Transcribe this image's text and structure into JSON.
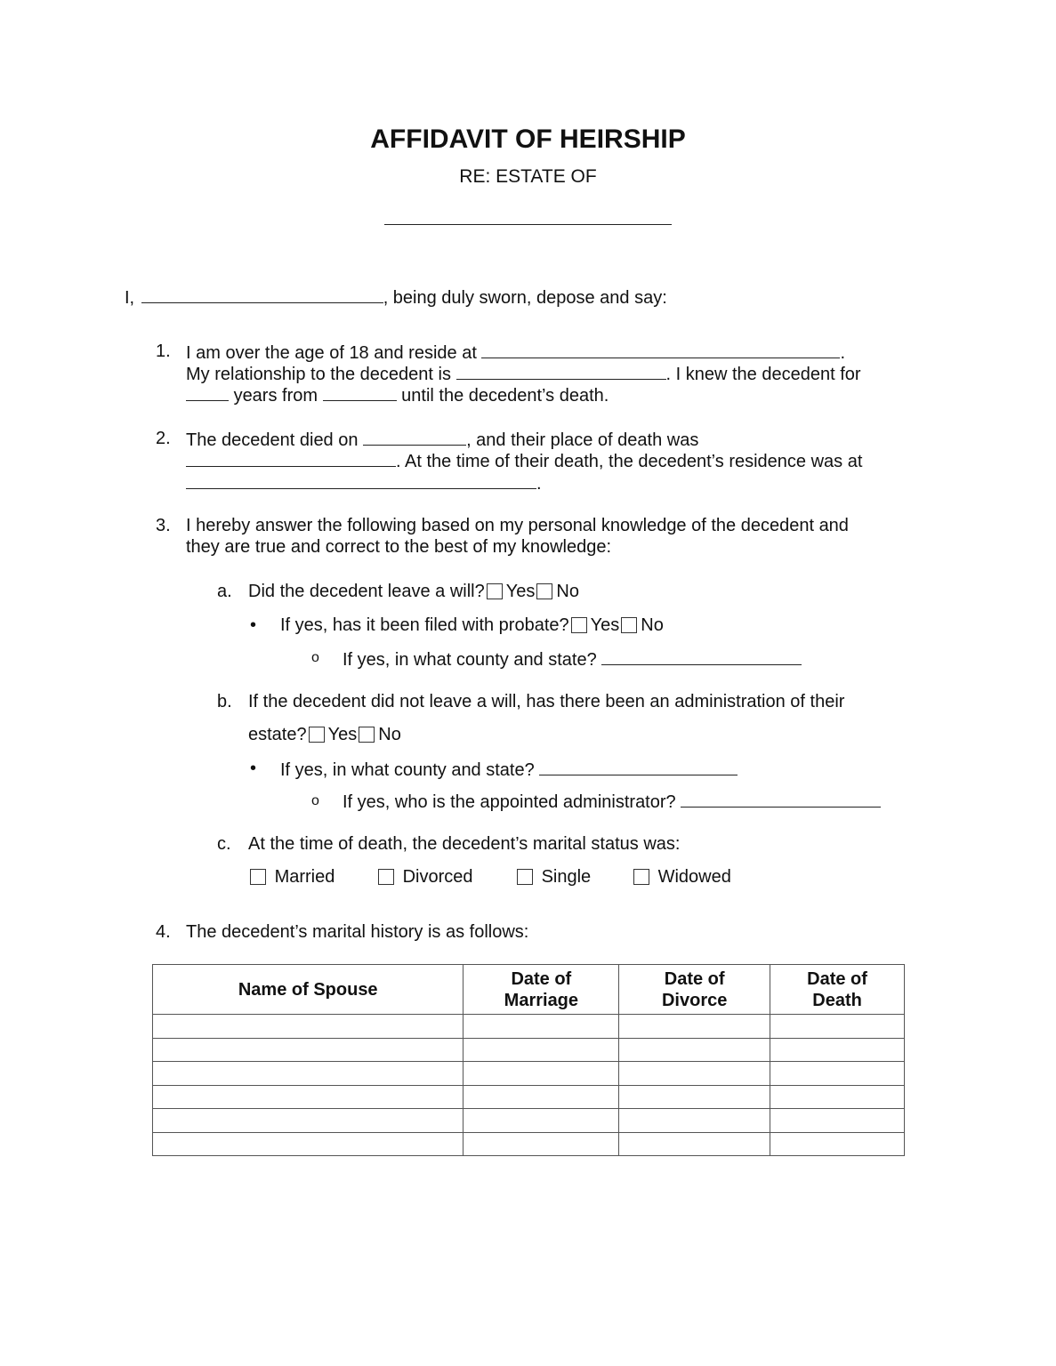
{
  "header": {
    "title": "AFFIDAVIT OF HEIRSHIP",
    "subtitle": "RE: ESTATE OF"
  },
  "intro": {
    "prefix": "I,",
    "suffix": ", being duly sworn, depose and say:"
  },
  "item1": {
    "number": "1.",
    "line1_text": "I am over the age of 18 and reside at",
    "line1_end": ".",
    "line2_text": "My relationship to the decedent is",
    "line2_end": ". I knew the decedent for",
    "line3_mid": "years from",
    "line3_end": "until the decedent’s death."
  },
  "item2": {
    "number": "2.",
    "line1_text": "The decedent died on",
    "line1_end": ", and their place of death was",
    "line2_end": ". At the time of their death, the decedent’s residence was at",
    "line3_end": "."
  },
  "item3": {
    "number": "3.",
    "line1": "I hereby answer the following based on my personal knowledge of the decedent and",
    "line2": "they are true and correct to the best of my knowledge:",
    "a": {
      "letter": "a.",
      "question": "Did the decedent leave a will?",
      "yes": "Yes",
      "no": "No",
      "bullet_question": "If yes, has it been filed with probate?",
      "bullet_yes": "Yes",
      "bullet_no": "No",
      "sub_question": "If yes, in what county and state?"
    },
    "b": {
      "letter": "b.",
      "question_line1": "If the decedent did not leave a will, has there been an administration of their",
      "question_line2": "estate?",
      "yes": "Yes",
      "no": "No",
      "bullet_question": "If yes, in what county and state?",
      "sub_question": "If yes, who is the appointed administrator?"
    },
    "c": {
      "letter": "c.",
      "question": "At the time of death, the decedent’s marital status was:",
      "options": [
        "Married",
        "Divorced",
        "Single",
        "Widowed"
      ]
    }
  },
  "item4": {
    "number": "4.",
    "text": "The decedent’s marital history is as follows:"
  },
  "marital_table": {
    "headers": [
      "Name of Spouse",
      "Date of Marriage",
      "Date of Divorce",
      "Date of Death"
    ],
    "rows": [
      [
        "",
        "",
        "",
        ""
      ],
      [
        "",
        "",
        "",
        ""
      ],
      [
        "",
        "",
        "",
        ""
      ],
      [
        "",
        "",
        "",
        ""
      ],
      [
        "",
        "",
        "",
        ""
      ],
      [
        "",
        "",
        "",
        ""
      ]
    ]
  }
}
